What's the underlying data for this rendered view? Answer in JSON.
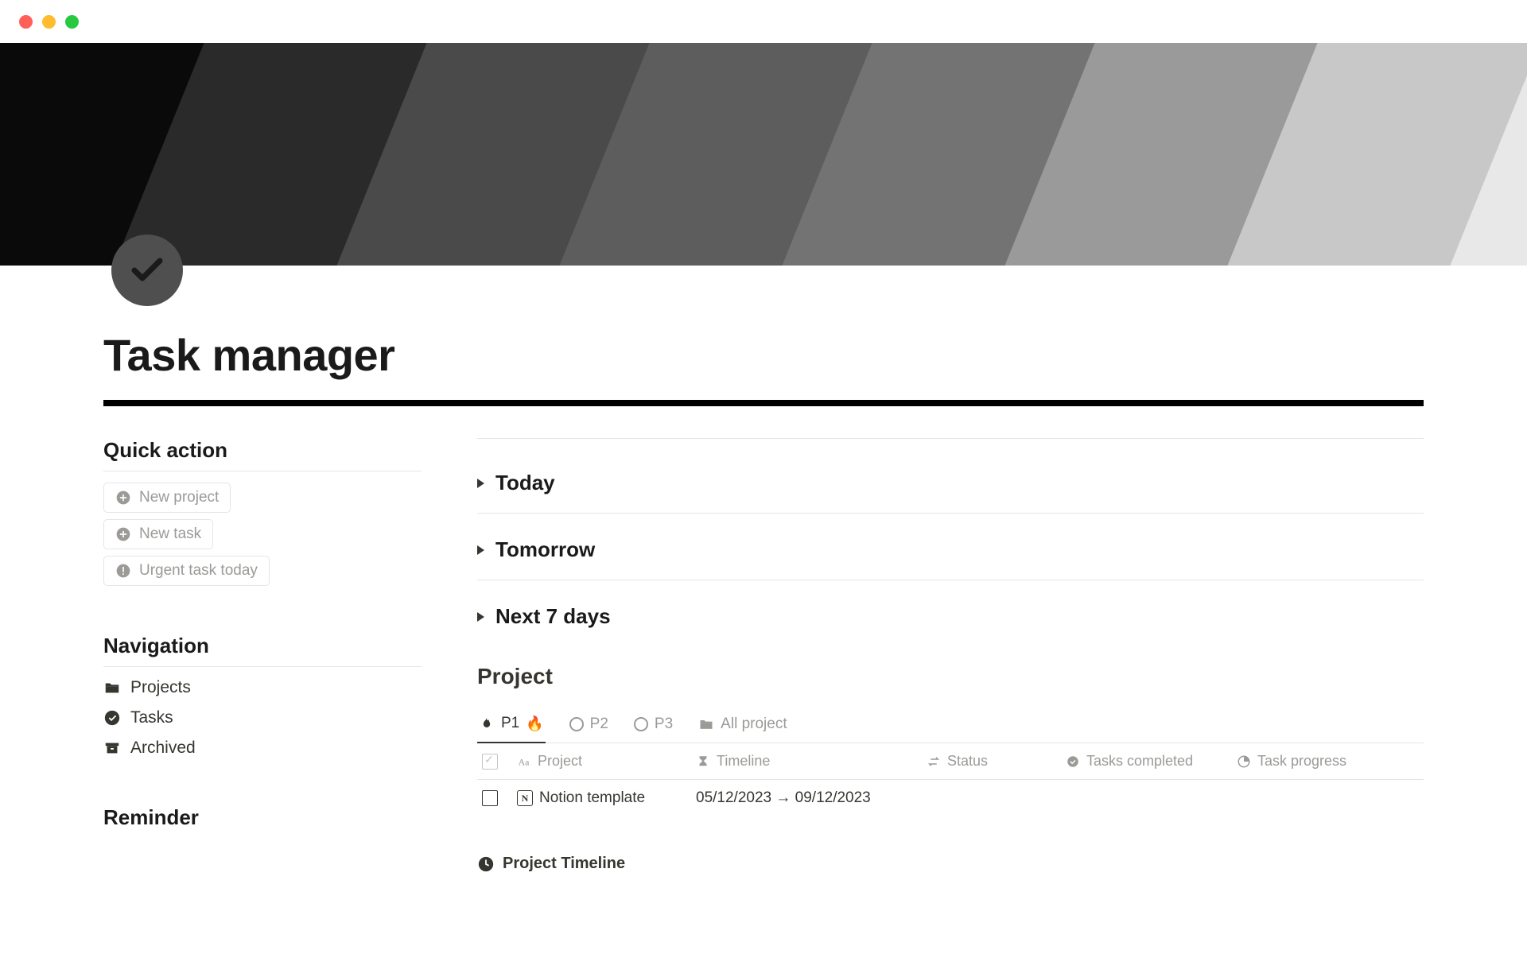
{
  "page": {
    "title": "Task manager"
  },
  "sidebar": {
    "quick_action": {
      "heading": "Quick action",
      "items": [
        {
          "label": "New project"
        },
        {
          "label": "New task"
        },
        {
          "label": "Urgent task today"
        }
      ]
    },
    "navigation": {
      "heading": "Navigation",
      "items": [
        {
          "label": "Projects"
        },
        {
          "label": "Tasks"
        },
        {
          "label": "Archived"
        }
      ]
    },
    "reminder": {
      "heading": "Reminder"
    }
  },
  "main": {
    "toggles": [
      {
        "label": "Today"
      },
      {
        "label": "Tomorrow"
      },
      {
        "label": "Next 7 days"
      }
    ],
    "project": {
      "heading": "Project",
      "tabs": [
        {
          "label": "P1"
        },
        {
          "label": "P2"
        },
        {
          "label": "P3"
        },
        {
          "label": "All project"
        }
      ],
      "columns": {
        "project": "Project",
        "timeline": "Timeline",
        "status": "Status",
        "tasks_completed": "Tasks completed",
        "task_progress": "Task progress"
      },
      "rows": [
        {
          "name": "Notion template",
          "timeline": "05/12/2023 → 09/12/2023"
        }
      ]
    },
    "timeline_footer": "Project Timeline"
  }
}
